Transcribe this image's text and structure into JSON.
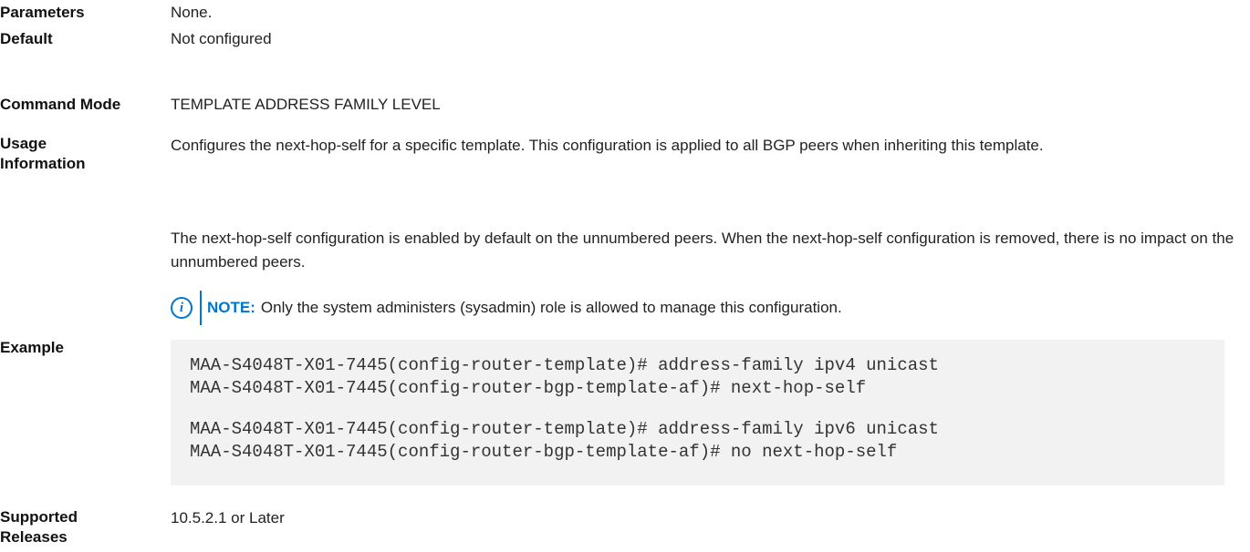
{
  "sections": {
    "parameters": {
      "label": "Parameters",
      "value": "None."
    },
    "default": {
      "label": "Default",
      "value": "Not configured"
    },
    "command_mode": {
      "label": "Command Mode",
      "value": "TEMPLATE ADDRESS FAMILY LEVEL"
    },
    "usage": {
      "label_line1": "Usage",
      "label_line2": "Information",
      "para1": "Configures the next-hop-self for a specific template. This configuration is applied to all BGP peers when inheriting this template.",
      "para2": "The next-hop-self configuration is enabled by default on the unnumbered peers. When the next-hop-self configuration is removed, there is no impact on the unnumbered peers.",
      "note": {
        "icon": "info-icon",
        "title": "NOTE:",
        "text": "Only the system administers (sysadmin) role is allowed to manage this configuration."
      }
    },
    "example": {
      "label": "Example",
      "lines": [
        "MAA-S4048T-X01-7445(config-router-template)# address-family ipv4 unicast",
        "MAA-S4048T-X01-7445(config-router-bgp-template-af)# next-hop-self",
        "MAA-S4048T-X01-7445(config-router-template)# address-family ipv6 unicast",
        "MAA-S4048T-X01-7445(config-router-bgp-template-af)# no next-hop-self"
      ]
    },
    "supported_releases": {
      "label_line1": "Supported",
      "label_line2": "Releases",
      "value": "10.5.2.1 or Later"
    }
  },
  "colors": {
    "accent": "#0076ce",
    "code_background": "#f2f2f2"
  }
}
